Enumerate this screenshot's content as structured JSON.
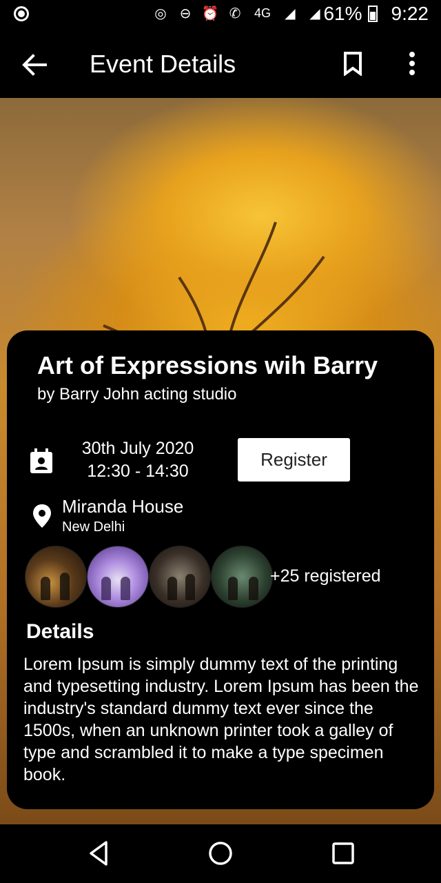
{
  "status_bar": {
    "battery": "61%",
    "time": "9:22",
    "network": "4G",
    "icons": [
      "hotspot-icon",
      "dnd-icon",
      "alarm-icon",
      "volte-call-icon",
      "signal-icon",
      "signal-icon",
      "battery-icon"
    ]
  },
  "app_bar": {
    "title": "Event Details",
    "icons": [
      "back-arrow-icon",
      "bookmark-icon",
      "more-vert-icon"
    ]
  },
  "event": {
    "title": "Art of Expressions wih Barry",
    "organizer": "by Barry John acting studio",
    "date": "30th July 2020",
    "time": "12:30 - 14:30",
    "register_label": "Register",
    "venue": "Miranda House",
    "city": "New Delhi",
    "registered_count": "+25 registered"
  },
  "details": {
    "heading": "Details",
    "body": "Lorem Ipsum is simply dummy text of the printing and typesetting industry. Lorem Ipsum has been the industry's standard dummy text ever since the 1500s, when an unknown printer took a galley of type and scrambled it to make a type specimen book."
  },
  "nav_bar": {
    "icons": [
      "nav-back-icon",
      "nav-home-icon",
      "nav-recents-icon"
    ]
  },
  "colors": {
    "background": "#000000",
    "text": "#ffffff",
    "button_bg": "#ffffff",
    "button_text": "#222222",
    "hero_accent": "#f2b020"
  }
}
